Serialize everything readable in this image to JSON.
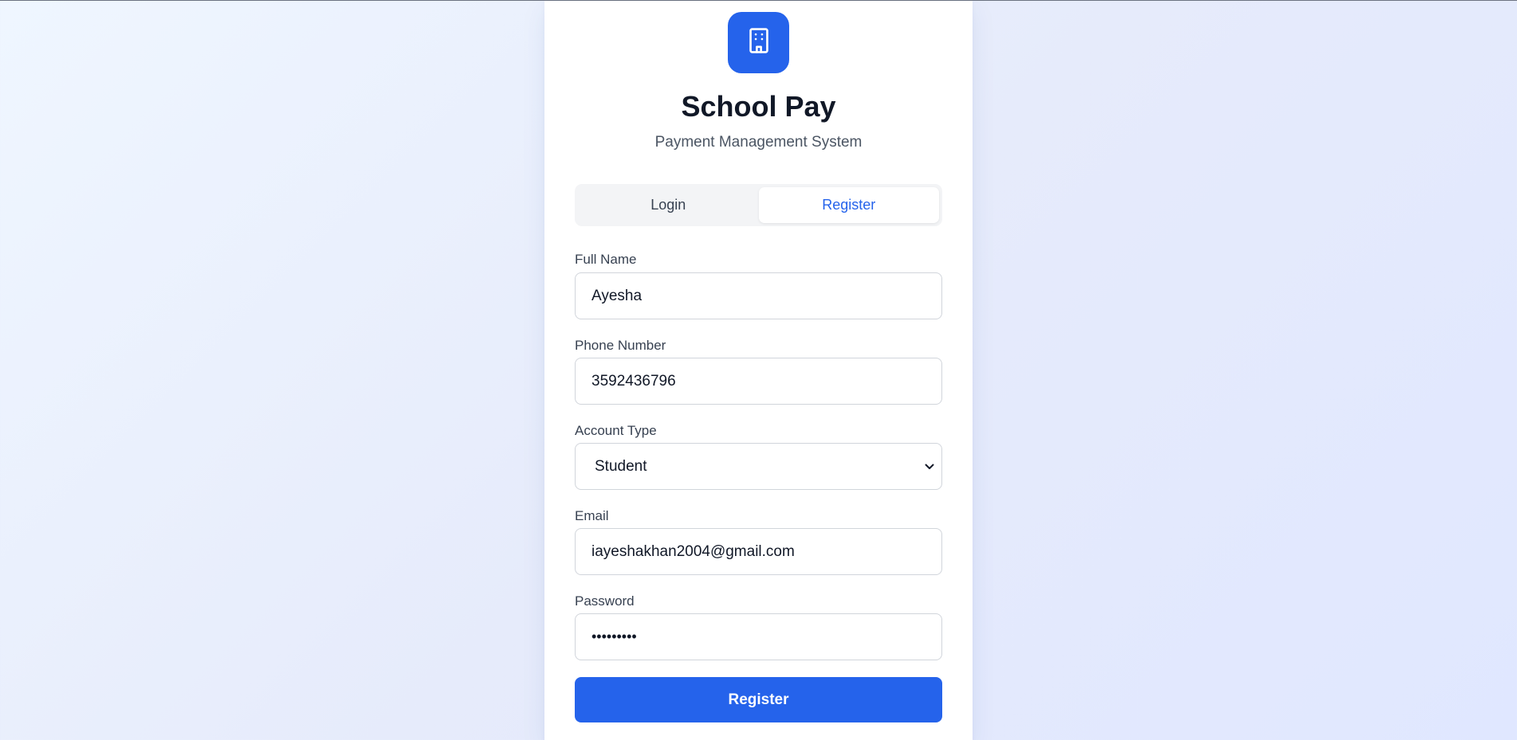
{
  "app": {
    "title": "School Pay",
    "subtitle": "Payment Management System",
    "logo_icon": "building-icon",
    "accent_color": "#2563eb"
  },
  "tabs": [
    {
      "label": "Login",
      "active": false
    },
    {
      "label": "Register",
      "active": true
    }
  ],
  "form": {
    "full_name": {
      "label": "Full Name",
      "value": "Ayesha"
    },
    "phone": {
      "label": "Phone Number",
      "value": "3592436796"
    },
    "account_type": {
      "label": "Account Type",
      "value": "Student"
    },
    "email": {
      "label": "Email",
      "value": "iayeshakhan2004@gmail.com"
    },
    "password": {
      "label": "Password",
      "masked_value": "•••••••••"
    },
    "submit_label": "Register"
  }
}
